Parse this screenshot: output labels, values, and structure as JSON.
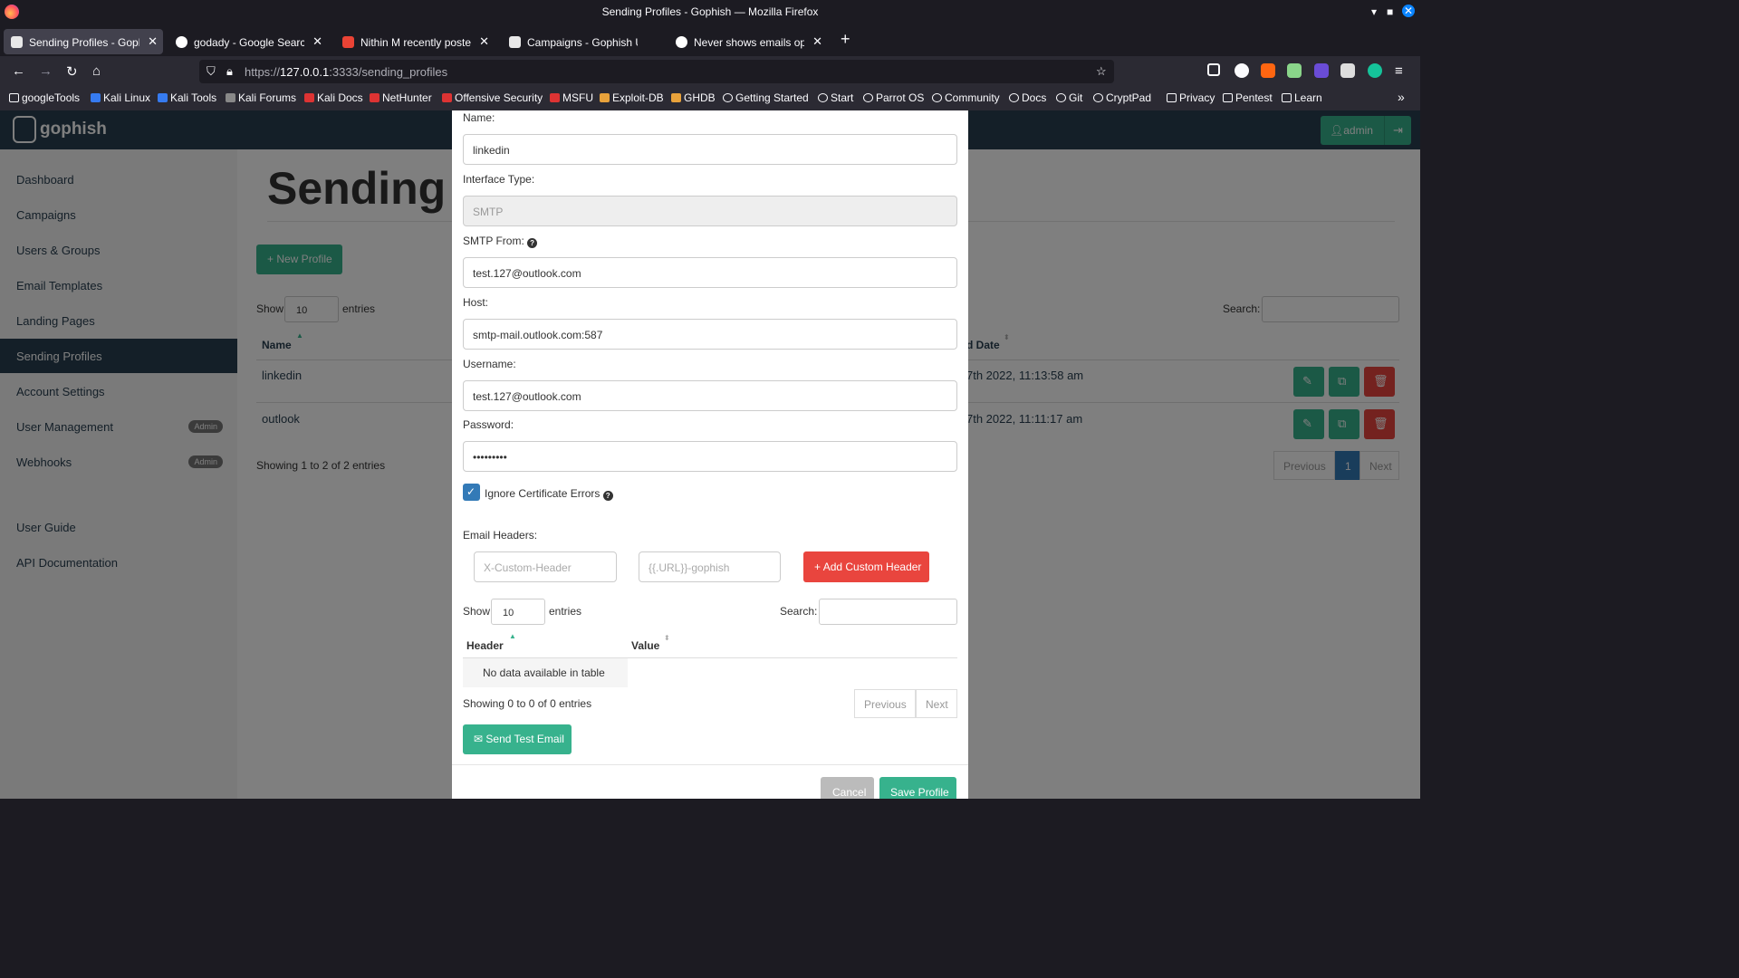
{
  "window": {
    "title": "Sending Profiles - Gophish — Mozilla Firefox"
  },
  "tabs": [
    {
      "label": "Sending Profiles - Gophish"
    },
    {
      "label": "godady - Google Search"
    },
    {
      "label": "Nithin M recently posted - ·"
    },
    {
      "label": "Campaigns - Gophish User"
    },
    {
      "label": "Never shows emails opene"
    }
  ],
  "url": {
    "scheme": "https://",
    "host": "127.0.0.1",
    "rest": ":3333/sending_profiles"
  },
  "bookmarks": [
    "googleTools",
    "Kali Linux",
    "Kali Tools",
    "Kali Forums",
    "Kali Docs",
    "NetHunter",
    "Offensive Security",
    "MSFU",
    "Exploit-DB",
    "GHDB",
    "Getting Started",
    "Start",
    "Parrot OS",
    "Community",
    "Docs",
    "Git",
    "CryptPad",
    "Privacy",
    "Pentest",
    "Learn"
  ],
  "app": {
    "brand": "gophish",
    "admin_label": "admin"
  },
  "sidebar": {
    "items": [
      {
        "label": "Dashboard"
      },
      {
        "label": "Campaigns"
      },
      {
        "label": "Users & Groups"
      },
      {
        "label": "Email Templates"
      },
      {
        "label": "Landing Pages"
      },
      {
        "label": "Sending Profiles"
      },
      {
        "label": "Account Settings"
      },
      {
        "label": "User Management",
        "badge": "Admin"
      },
      {
        "label": "Webhooks",
        "badge": "Admin"
      },
      {
        "label": "User Guide"
      },
      {
        "label": "API Documentation"
      }
    ]
  },
  "page": {
    "title": "Sending P",
    "new_profile": "New Profile",
    "show": "Show",
    "entries": "entries",
    "entries_count": "10",
    "search": "Search:",
    "col_name": "Name",
    "col_date": "d Date",
    "rows": [
      {
        "name": "linkedin",
        "date": "7th 2022, 11:13:58 am"
      },
      {
        "name": "outlook",
        "date": "7th 2022, 11:11:17 am"
      }
    ],
    "showing": "Showing 1 to 2 of 2 entries",
    "prev": "Previous",
    "page_num": "1",
    "next": "Next"
  },
  "modal": {
    "name_label": "Name:",
    "name_value": "linkedin",
    "interface_label": "Interface Type:",
    "interface_value": "SMTP",
    "from_label": "SMTP From:",
    "from_value": "test.127@outlook.com",
    "host_label": "Host:",
    "host_value": "smtp-mail.outlook.com:587",
    "username_label": "Username:",
    "username_value": "test.127@outlook.com",
    "password_label": "Password:",
    "password_value": "•••••••••",
    "ignore_cert": "Ignore Certificate Errors",
    "headers_label": "Email Headers:",
    "header_placeholder": "X-Custom-Header",
    "value_placeholder": "{{.URL}}-gophish",
    "add_header": "Add Custom Header",
    "show": "Show",
    "entries_count": "10",
    "entries": "entries",
    "search": "Search:",
    "col_header": "Header",
    "col_value": "Value",
    "no_data": "No data available in table",
    "showing": "Showing 0 to 0 of 0 entries",
    "prev": "Previous",
    "next": "Next",
    "send_test": "Send Test Email",
    "cancel": "Cancel",
    "save": "Save Profile"
  }
}
